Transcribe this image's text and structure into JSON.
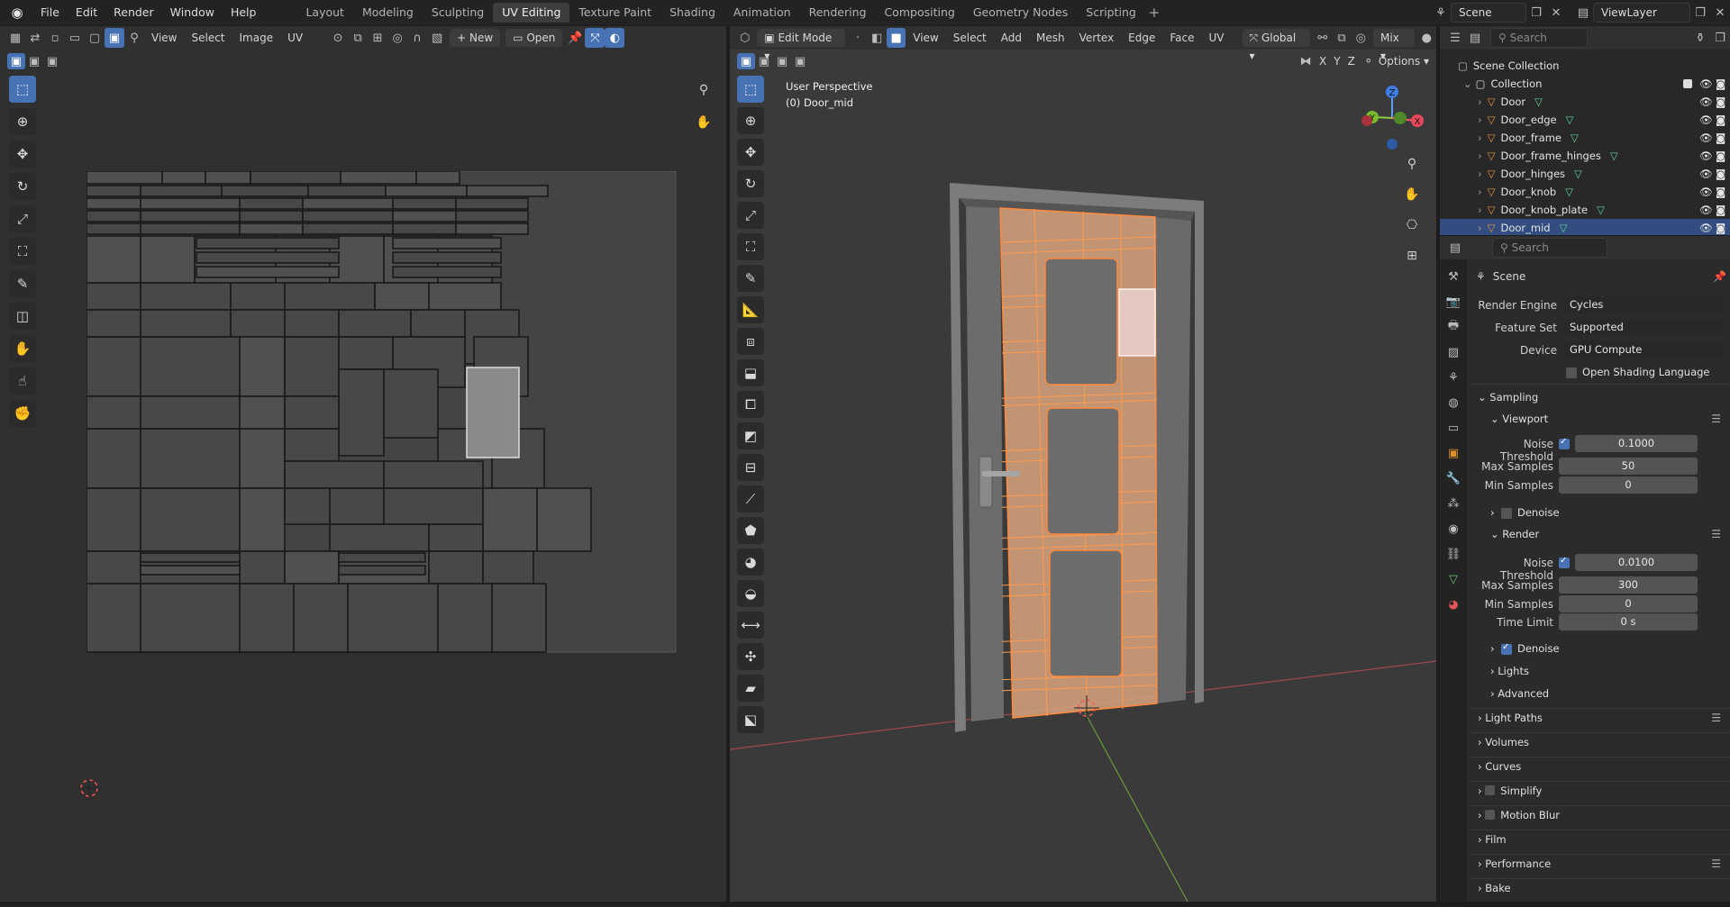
{
  "menu": [
    "File",
    "Edit",
    "Render",
    "Window",
    "Help"
  ],
  "workspaces": [
    "Layout",
    "Modeling",
    "Sculpting",
    "UV Editing",
    "Texture Paint",
    "Shading",
    "Animation",
    "Rendering",
    "Compositing",
    "Geometry Nodes",
    "Scripting"
  ],
  "active_workspace": "UV Editing",
  "scene_name": "Scene",
  "view_layer": "ViewLayer",
  "uv_editor": {
    "menus": [
      "View",
      "Select",
      "Image",
      "UV"
    ],
    "new_label": "New",
    "open_label": "Open"
  },
  "viewport": {
    "mode": "Edit Mode",
    "menus": [
      "View",
      "Select",
      "Add",
      "Mesh",
      "Vertex",
      "Edge",
      "Face",
      "UV"
    ],
    "orientation": "Global",
    "shading": "Mix",
    "options_label": "Options",
    "axes": [
      "X",
      "Y",
      "Z"
    ],
    "overlay_title": "User Perspective",
    "overlay_object": "(0) Door_mid",
    "gizmo": {
      "x": "X",
      "y": "Y",
      "z": "Z"
    }
  },
  "outliner": {
    "search_placeholder": "Search",
    "scene_collection": "Scene Collection",
    "collection": "Collection",
    "objects": [
      "Door",
      "Door_edge",
      "Door_frame",
      "Door_frame_hinges",
      "Door_hinges",
      "Door_knob",
      "Door_knob_plate",
      "Door_mid"
    ],
    "selected": "Door_mid"
  },
  "properties": {
    "search_placeholder": "Search",
    "context": "Scene",
    "render_engine_label": "Render Engine",
    "render_engine": "Cycles",
    "feature_set_label": "Feature Set",
    "feature_set": "Supported",
    "device_label": "Device",
    "device": "GPU Compute",
    "osl_label": "Open Shading Language",
    "sampling": "Sampling",
    "viewport_label": "Viewport",
    "noise_threshold_label": "Noise Threshold",
    "viewport_noise": "0.1000",
    "max_samples_label": "Max Samples",
    "viewport_max": "50",
    "min_samples_label": "Min Samples",
    "viewport_min": "0",
    "denoise_label": "Denoise",
    "render_label": "Render",
    "render_noise": "0.0100",
    "render_max": "300",
    "render_min": "0",
    "time_limit_label": "Time Limit",
    "time_limit": "0 s",
    "lights_label": "Lights",
    "advanced_label": "Advanced",
    "panels": [
      "Light Paths",
      "Volumes",
      "Curves",
      "Simplify",
      "Motion Blur",
      "Film",
      "Performance",
      "Bake"
    ]
  },
  "colors": {
    "accent": "#4772b3",
    "select_orange": "#ff8a3d",
    "face_fill": "#d9a57f"
  }
}
